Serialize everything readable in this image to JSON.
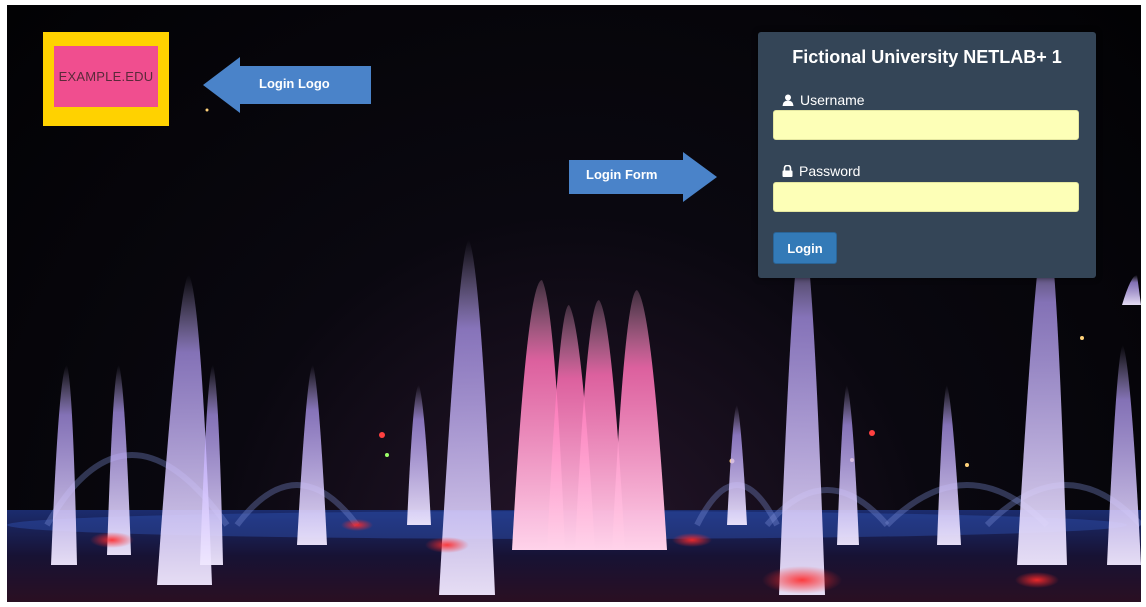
{
  "logo": {
    "text": "EXAMPLE.EDU"
  },
  "annotations": {
    "logo_callout": "Login Logo",
    "form_callout": "Login Form"
  },
  "login": {
    "title": "Fictional University NETLAB+ 1",
    "username_label": "Username",
    "username_value": "",
    "password_label": "Password",
    "password_value": "",
    "submit_label": "Login"
  },
  "colors": {
    "logo_border": "#ffd200",
    "logo_fill": "#f04e8f",
    "callout_arrow": "#4a83c9",
    "panel_bg": "#344557",
    "input_bg": "#fdffb7",
    "button": "#337ab7"
  }
}
